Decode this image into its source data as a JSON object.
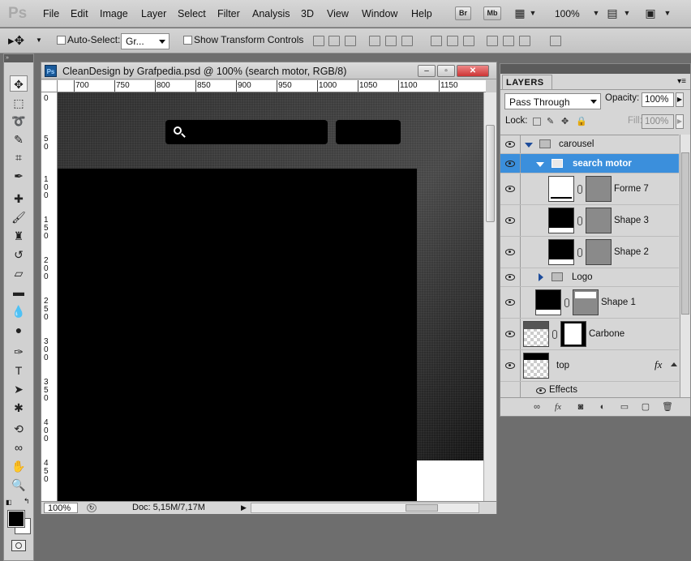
{
  "app": {
    "logo": "Ps",
    "menu": [
      "File",
      "Edit",
      "Image",
      "Layer",
      "Select",
      "Filter",
      "Analysis",
      "3D",
      "View",
      "Window",
      "Help"
    ],
    "bridge_button": "Br",
    "minibridge_button": "Mb",
    "zoom": "100%"
  },
  "options": {
    "auto_select_label": "Auto-Select:",
    "auto_select_value": "Gr...",
    "show_transform_label": "Show Transform Controls"
  },
  "document": {
    "title": "CleanDesign by Grafpedia.psd @ 100% (search motor, RGB/8)",
    "ruler_h": [
      "700",
      "750",
      "800",
      "850",
      "900",
      "950",
      "1000",
      "1050",
      "1100",
      "1150"
    ],
    "ruler_v": [
      "0",
      "50",
      "100",
      "150",
      "200",
      "250",
      "300",
      "350",
      "400",
      "450"
    ],
    "zoom": "100%",
    "doc_info": "Doc: 5,15M/7,17M"
  },
  "layers_panel": {
    "tab": "LAYERS",
    "blend_mode": "Pass Through",
    "opacity_label": "Opacity:",
    "opacity": "100%",
    "lock_label": "Lock:",
    "fill_label": "Fill:",
    "fill": "100%",
    "rows": [
      {
        "name": "carousel"
      },
      {
        "name": "search motor"
      },
      {
        "name": "Forme 7"
      },
      {
        "name": "Shape 3"
      },
      {
        "name": "Shape 2"
      },
      {
        "name": "Logo"
      },
      {
        "name": "Shape 1"
      },
      {
        "name": "Carbone"
      },
      {
        "name": "top"
      },
      {
        "name": "Effects"
      }
    ],
    "fx_label": "fx"
  },
  "colors": {
    "selection": "#3b8fdc",
    "canvas_dark": "#000000"
  }
}
